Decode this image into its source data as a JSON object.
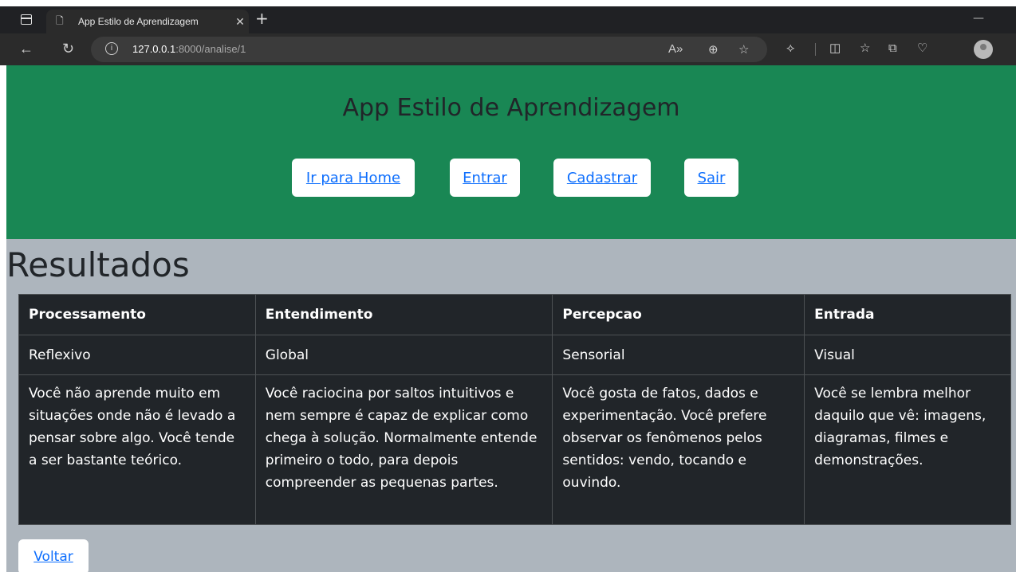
{
  "browser": {
    "tab_title": "App Estilo de Aprendizagem",
    "url_host": "127.0.0.1",
    "url_path": ":8000/analise/1"
  },
  "header": {
    "title": "App Estilo de Aprendizagem",
    "nav": [
      "Ir para Home",
      "Entrar",
      "Cadastrar",
      "Sair"
    ]
  },
  "main": {
    "title": "Resultados",
    "table": {
      "headers": [
        "Processamento",
        "Entendimento",
        "Percepcao",
        "Entrada"
      ],
      "types": [
        "Reflexivo",
        "Global",
        "Sensorial",
        "Visual"
      ],
      "descriptions": [
        "Você não aprende muito em situações onde não é levado a pensar sobre algo. Você tende a ser bastante teórico.",
        "Você raciocina por saltos intuitivos e nem sempre é capaz de explicar como chega à solução. Normalmente entende primeiro o todo, para depois compreender as pequenas partes.",
        "Você gosta de fatos, dados e experimentação. Você prefere observar os fenômenos pelos sentidos: vendo, tocando e ouvindo.",
        "Você se lembra melhor daquilo que vê: imagens, diagramas, filmes e demonstrações."
      ]
    },
    "back_label": "Voltar"
  },
  "colors": {
    "header_bg": "#198754",
    "page_bg": "#adb5bd",
    "table_bg": "#212529",
    "link": "#0d6efd"
  }
}
